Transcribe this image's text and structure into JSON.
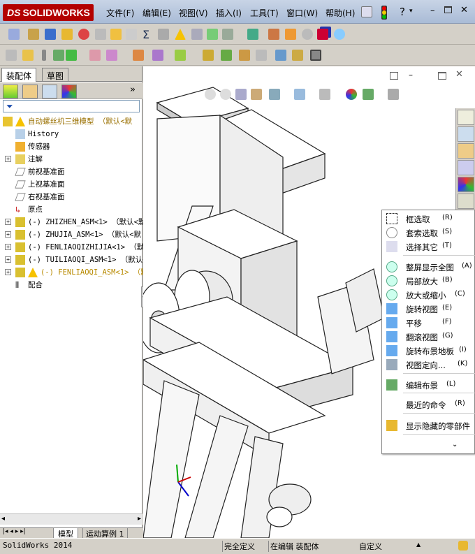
{
  "app": {
    "logo": "SOLIDWORKS",
    "logo_prefix": "DS"
  },
  "menu": [
    "文件(F)",
    "编辑(E)",
    "视图(V)",
    "插入(I)",
    "工具(T)",
    "窗口(W)",
    "帮助(H)"
  ],
  "panel_tabs": {
    "assembly": "装配体",
    "sketch": "草图"
  },
  "tree": [
    {
      "label": "自动螺丝机三维模型 （默认<默",
      "expand": false,
      "icon": "assembly-warning"
    },
    {
      "label": "History",
      "expand": false,
      "icon": "history"
    },
    {
      "label": "传感器",
      "expand": false,
      "icon": "sensor"
    },
    {
      "label": "注解",
      "expand": true,
      "icon": "annotation"
    },
    {
      "label": "前视基准面",
      "expand": false,
      "icon": "plane"
    },
    {
      "label": "上视基准面",
      "expand": false,
      "icon": "plane"
    },
    {
      "label": "右视基准面",
      "expand": false,
      "icon": "plane"
    },
    {
      "label": "原点",
      "expand": false,
      "icon": "origin"
    },
    {
      "label": "(-) ZHIZHEN_ASM<1> （默认<默",
      "expand": true,
      "icon": "subassembly"
    },
    {
      "label": "(-) ZHUJIA_ASM<1> （默认<默",
      "expand": true,
      "icon": "subassembly"
    },
    {
      "label": "(-) FENLIAOQIZHIJIA<1> （默认",
      "expand": true,
      "icon": "subassembly"
    },
    {
      "label": "(-) TUILIAOQI_ASM<1> （默认<",
      "expand": true,
      "icon": "subassembly"
    },
    {
      "label": "(-) FENLIAOQI_ASM<1> （默",
      "expand": true,
      "icon": "subassembly-warning"
    },
    {
      "label": "配合",
      "expand": false,
      "icon": "mates"
    }
  ],
  "bottom_tabs": {
    "model": "模型",
    "motion": "运动算例 1"
  },
  "status": {
    "app_version": "SolidWorks 2014",
    "definition": "完全定义",
    "editing": "在编辑 装配体",
    "custom": "自定义"
  },
  "context_menu": [
    {
      "label": "框选取",
      "shortcut": "(R)",
      "icon": "box-select-icon"
    },
    {
      "label": "套索选取",
      "shortcut": "(S)",
      "icon": "lasso-select-icon"
    },
    {
      "label": "选择其它",
      "shortcut": "(T)",
      "icon": "select-other-icon"
    },
    {
      "label": "整屏显示全图",
      "shortcut": "(A)",
      "icon": "zoom-fit-icon"
    },
    {
      "label": "局部放大",
      "shortcut": "(B)",
      "icon": "zoom-area-icon"
    },
    {
      "label": "放大或缩小",
      "shortcut": "(C)",
      "icon": "zoom-in-out-icon"
    },
    {
      "label": "旋转视图",
      "shortcut": "(E)",
      "icon": "rotate-view-icon"
    },
    {
      "label": "平移",
      "shortcut": "(F)",
      "icon": "pan-icon"
    },
    {
      "label": "翻滚视图",
      "shortcut": "(G)",
      "icon": "roll-view-icon"
    },
    {
      "label": "旋转布景地板",
      "shortcut": "(I)",
      "icon": "rotate-floor-icon"
    },
    {
      "label": "视图定向...",
      "shortcut": "(K)",
      "icon": "view-orientation-icon"
    },
    {
      "label": "编辑布景",
      "shortcut": "(L)",
      "icon": "edit-scene-icon"
    },
    {
      "label": "最近的命令",
      "shortcut": "(R)",
      "icon": "recent-commands-icon"
    },
    {
      "label": "显示隐藏的零部件",
      "shortcut": "",
      "icon": "show-hidden-components-icon"
    }
  ]
}
